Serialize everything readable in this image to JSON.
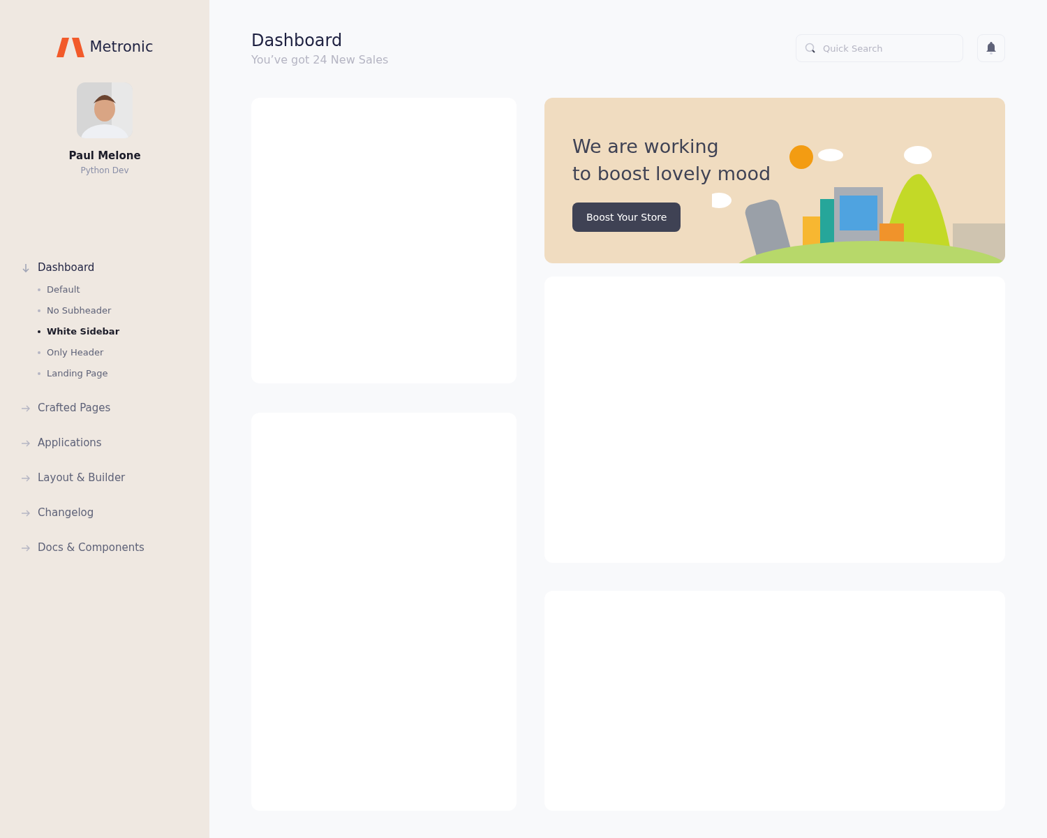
{
  "brand": {
    "name": "Metronic"
  },
  "profile": {
    "name": "Paul Melone",
    "role": "Python Dev"
  },
  "nav": [
    {
      "label": "Dashboard",
      "expanded": true,
      "children": [
        {
          "label": "Default",
          "selected": false
        },
        {
          "label": "No Subheader",
          "selected": false
        },
        {
          "label": "White Sidebar",
          "selected": true
        },
        {
          "label": "Only Header",
          "selected": false
        },
        {
          "label": "Landing Page",
          "selected": false
        }
      ]
    },
    {
      "label": "Crafted Pages",
      "expanded": false
    },
    {
      "label": "Applications",
      "expanded": false
    },
    {
      "label": "Layout & Builder",
      "expanded": false
    },
    {
      "label": "Changelog",
      "expanded": false
    },
    {
      "label": "Docs & Components",
      "expanded": false
    }
  ],
  "header": {
    "title": "Dashboard",
    "subtitle": "You’ve got 24 New Sales"
  },
  "search": {
    "placeholder": "Quick Search"
  },
  "banner": {
    "heading_lines": [
      "We are working",
      "to boost lovely mood"
    ],
    "button": "Boost Your Store"
  }
}
